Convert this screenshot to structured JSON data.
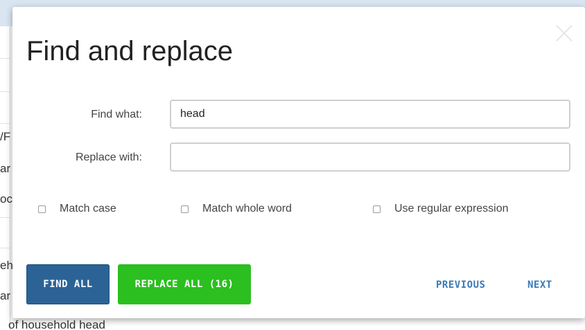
{
  "background": {
    "fragments": [
      "/F",
      "ar",
      "oc",
      "eh",
      "ar"
    ],
    "bottom_text": "of household head"
  },
  "dialog": {
    "title": "Find and replace",
    "find_label": "Find what:",
    "find_value": "head",
    "replace_label": "Replace with:",
    "replace_value": "",
    "options": [
      {
        "label": "Match case",
        "checked": false
      },
      {
        "label": "Match whole word",
        "checked": false
      },
      {
        "label": "Use regular expression",
        "checked": false
      }
    ],
    "buttons": {
      "find_all": "FIND ALL",
      "replace_all": "REPLACE ALL (16)",
      "previous": "PREVIOUS",
      "next": "NEXT"
    }
  },
  "colors": {
    "find_all_bg": "#2c6396",
    "replace_all_bg": "#2bbf1f",
    "link": "#3a7ab8"
  }
}
